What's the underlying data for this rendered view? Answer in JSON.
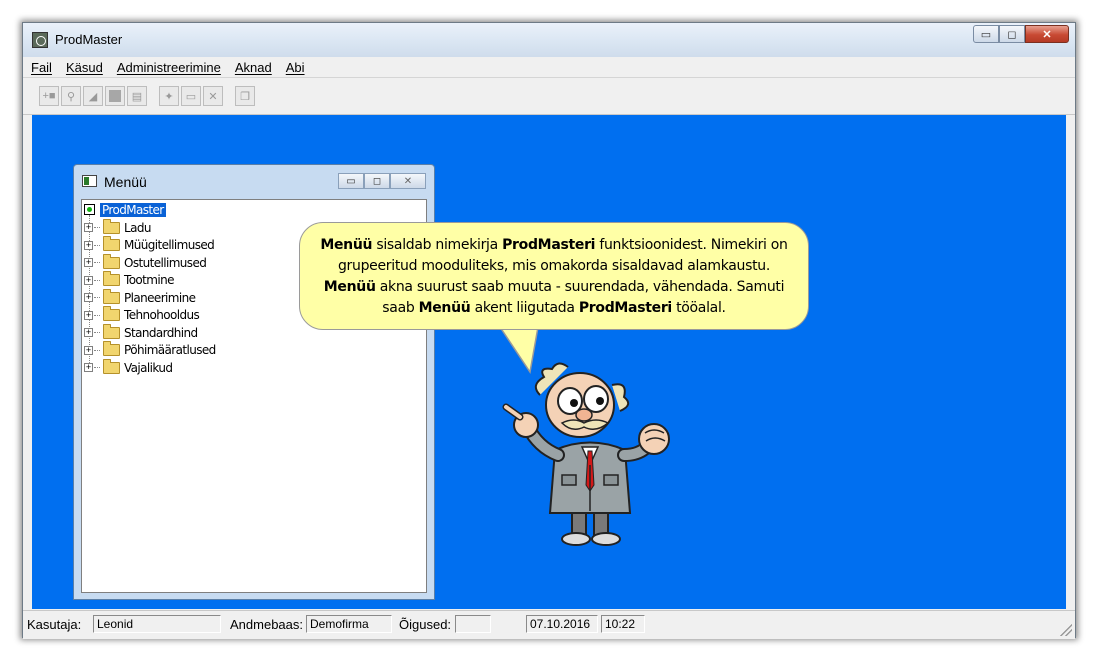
{
  "window": {
    "title": "ProdMaster",
    "controls": {
      "minimize": "▭",
      "maximize": "◻",
      "close": "✕"
    }
  },
  "menubar": [
    "Fail",
    "Käsud",
    "Administreerimine",
    "Aknad",
    "Abi"
  ],
  "toolbar": {
    "icons": [
      "add-record-icon",
      "binoculars-search-icon",
      "eraser-icon",
      "stop-icon",
      "document-edit-icon",
      "new-folder-icon",
      "folder-icon",
      "delete-icon",
      "copy-icon"
    ]
  },
  "child_window": {
    "title": "Menüü",
    "controls": {
      "minimize": "▭",
      "maximize": "◻",
      "close": "✕"
    },
    "tree": {
      "root": "ProdMaster",
      "items": [
        "Ladu",
        "Müügitellimused",
        "Ostutellimused",
        "Tootmine",
        "Planeerimine",
        "Tehnohooldus",
        "Standardhind",
        "Põhimäärat­lused",
        "Vajalikud"
      ]
    }
  },
  "bubble": {
    "segments": [
      {
        "t": "Menüü",
        "b": true
      },
      {
        "t": " sisaldab nimekirja ",
        "b": false
      },
      {
        "t": "ProdMasteri",
        "b": true
      },
      {
        "t": " funktsioonidest.  Nimekiri on grupeeritud mooduliteks, mis omakorda sisaldavad alamkaustu. ",
        "b": false
      },
      {
        "t": "Menüü",
        "b": true
      },
      {
        "t": " akna suurust saab muuta - suurendada, vähendada.  Samuti saab ",
        "b": false
      },
      {
        "t": "Menüü",
        "b": true
      },
      {
        "t": " akent liigutada ",
        "b": false
      },
      {
        "t": "ProdMasteri",
        "b": true
      },
      {
        "t": " tööalal.",
        "b": false
      }
    ]
  },
  "statusbar": {
    "user_label": "Kasutaja:",
    "user_value": "Leonid",
    "db_label": "Andmebaas:",
    "db_value": "Demofirma",
    "rights_label": "Õigused:",
    "rights_value": "",
    "date": "07.10.2016",
    "time": "10:22"
  },
  "colors": {
    "workspace": "#006ff0",
    "bubble": "#ffffa6",
    "selection": "#0a62d6"
  }
}
